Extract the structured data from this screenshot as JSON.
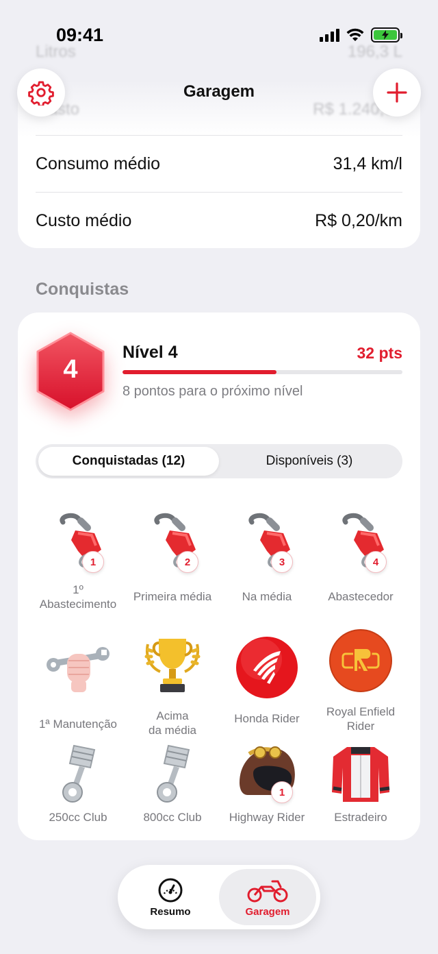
{
  "status_bar": {
    "time": "09:41"
  },
  "ghost_rows": [
    {
      "label": "Litros",
      "value": "196,3 L"
    },
    {
      "label": "Gasto",
      "value": "R$ 1.240,00"
    }
  ],
  "header": {
    "title": "Garagem"
  },
  "stats": [
    {
      "label": "Consumo médio",
      "value": "31,4 km/l"
    },
    {
      "label": "Custo médio",
      "value": "R$ 0,20/km"
    }
  ],
  "achievements": {
    "section_title": "Conquistas",
    "level_number": "4",
    "level_title": "Nível 4",
    "points": "32 pts",
    "progress_fraction": 0.55,
    "next_level_text": "8 pontos para o próximo nível",
    "tabs": [
      {
        "label": "Conquistadas (12)",
        "active": true
      },
      {
        "label": "Disponíveis (3)",
        "active": false
      }
    ],
    "badges": [
      {
        "icon": "fuel-pump-icon",
        "label": "1º Abastecimento",
        "count": "1"
      },
      {
        "icon": "fuel-pump-icon",
        "label": "Primeira média",
        "count": "2"
      },
      {
        "icon": "fuel-pump-icon",
        "label": "Na média",
        "count": "3"
      },
      {
        "icon": "fuel-pump-icon",
        "label": "Abastecedor",
        "count": "4"
      },
      {
        "icon": "wrench-fist-icon",
        "label": "1ª Manutenção",
        "count": ""
      },
      {
        "icon": "trophy-icon",
        "label": "Acima\nda média",
        "count": ""
      },
      {
        "icon": "honda-logo-icon",
        "label": "Honda Rider",
        "count": ""
      },
      {
        "icon": "royal-enfield-logo-icon",
        "label": "Royal Enfield\nRider",
        "count": ""
      },
      {
        "icon": "piston-icon",
        "label": "250cc Club",
        "count": ""
      },
      {
        "icon": "piston-icon",
        "label": "800cc Club",
        "count": ""
      },
      {
        "icon": "helmet-icon",
        "label": "Highway Rider",
        "count": "1"
      },
      {
        "icon": "jacket-icon",
        "label": "Estradeiro",
        "count": ""
      }
    ]
  },
  "tab_bar": [
    {
      "label": "Resumo",
      "icon": "speedometer-icon",
      "active": false
    },
    {
      "label": "Garagem",
      "icon": "motorcycle-icon",
      "active": true
    }
  ],
  "colors": {
    "accent": "#e11d2e",
    "background": "#efeff4",
    "card": "#ffffff"
  }
}
